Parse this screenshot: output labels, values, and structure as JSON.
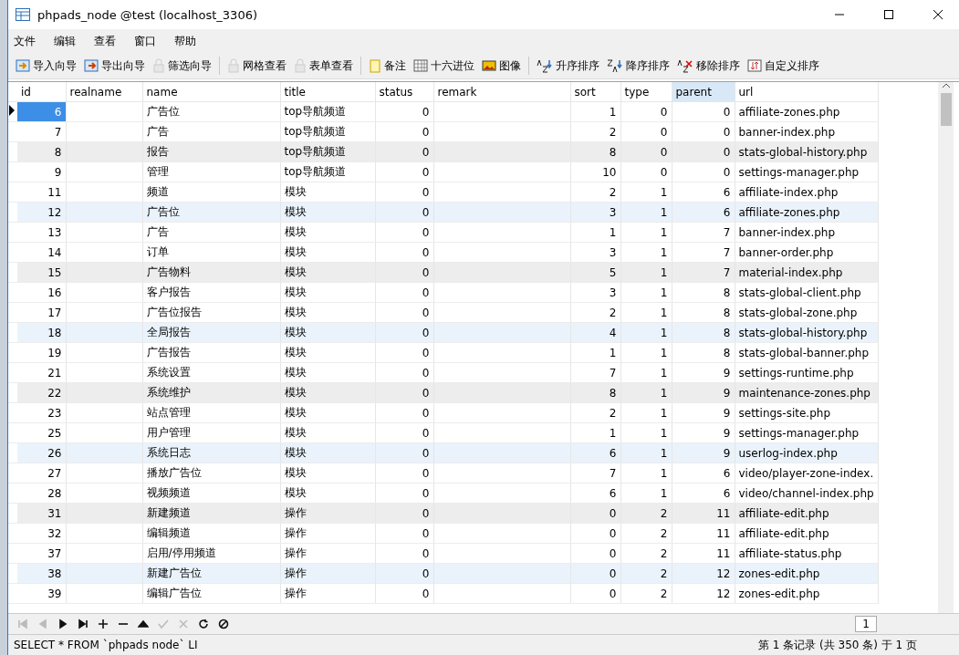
{
  "window": {
    "title": "phpads_node @test (localhost_3306)"
  },
  "menu": [
    "文件",
    "编辑",
    "查看",
    "窗口",
    "帮助"
  ],
  "toolbar": [
    [
      {
        "kind": "import",
        "label": "导入向导",
        "disabled": false
      },
      {
        "kind": "export",
        "label": "导出向导",
        "disabled": false
      },
      {
        "kind": "filter",
        "label": "筛选向导",
        "disabled": true
      }
    ],
    [
      {
        "kind": "grid",
        "label": "网格查看",
        "disabled": true
      },
      {
        "kind": "form",
        "label": "表单查看",
        "disabled": true
      }
    ],
    [
      {
        "kind": "note",
        "label": "备注",
        "disabled": false
      },
      {
        "kind": "hex",
        "label": "十六进位",
        "disabled": false
      },
      {
        "kind": "image",
        "label": "图像",
        "disabled": false
      }
    ],
    [
      {
        "kind": "asc",
        "label": "升序排序",
        "disabled": false
      },
      {
        "kind": "desc",
        "label": "降序排序",
        "disabled": false
      },
      {
        "kind": "remove",
        "label": "移除排序",
        "disabled": false
      },
      {
        "kind": "custom",
        "label": "自定义排序",
        "disabled": false
      }
    ]
  ],
  "table": {
    "columns": [
      {
        "label": "id",
        "selected": false
      },
      {
        "label": "realname",
        "selected": false
      },
      {
        "label": "name",
        "selected": false
      },
      {
        "label": "title",
        "selected": false
      },
      {
        "label": "status",
        "selected": false
      },
      {
        "label": "remark",
        "selected": false
      },
      {
        "label": "sort",
        "selected": false
      },
      {
        "label": "type",
        "selected": false
      },
      {
        "label": "parent",
        "selected": true
      },
      {
        "label": "url",
        "selected": false
      }
    ],
    "rows": [
      {
        "id": "6",
        "name": "广告位",
        "title": "top导航频道",
        "status": "0",
        "sort": "1",
        "type": "0",
        "parent": "0",
        "url": "affiliate-zones.php",
        "kind": "plain",
        "selected": true
      },
      {
        "id": "7",
        "name": "广告",
        "title": "top导航频道",
        "status": "0",
        "sort": "2",
        "type": "0",
        "parent": "0",
        "url": "banner-index.php",
        "kind": "plain",
        "selected": false
      },
      {
        "id": "8",
        "name": "报告",
        "title": "top导航频道",
        "status": "0",
        "sort": "8",
        "type": "0",
        "parent": "0",
        "url": "stats-global-history.php",
        "kind": "hovered",
        "selected": false
      },
      {
        "id": "9",
        "name": "管理",
        "title": "top导航频道",
        "status": "0",
        "sort": "10",
        "type": "0",
        "parent": "0",
        "url": "settings-manager.php",
        "kind": "plain",
        "selected": false
      },
      {
        "id": "11",
        "name": "频道",
        "title": "模块",
        "status": "0",
        "sort": "2",
        "type": "1",
        "parent": "6",
        "url": "affiliate-index.php",
        "kind": "plain",
        "selected": false
      },
      {
        "id": "12",
        "name": "广告位",
        "title": "模块",
        "status": "0",
        "sort": "3",
        "type": "1",
        "parent": "6",
        "url": "affiliate-zones.php",
        "kind": "tinted",
        "selected": false
      },
      {
        "id": "13",
        "name": "广告",
        "title": "模块",
        "status": "0",
        "sort": "1",
        "type": "1",
        "parent": "7",
        "url": "banner-index.php",
        "kind": "plain",
        "selected": false
      },
      {
        "id": "14",
        "name": "订单",
        "title": "模块",
        "status": "0",
        "sort": "3",
        "type": "1",
        "parent": "7",
        "url": "banner-order.php",
        "kind": "plain",
        "selected": false
      },
      {
        "id": "15",
        "name": "广告物料",
        "title": "模块",
        "status": "0",
        "sort": "5",
        "type": "1",
        "parent": "7",
        "url": "material-index.php",
        "kind": "hovered",
        "selected": false
      },
      {
        "id": "16",
        "name": "客户报告",
        "title": "模块",
        "status": "0",
        "sort": "3",
        "type": "1",
        "parent": "8",
        "url": "stats-global-client.php",
        "kind": "plain",
        "selected": false
      },
      {
        "id": "17",
        "name": "广告位报告",
        "title": "模块",
        "status": "0",
        "sort": "2",
        "type": "1",
        "parent": "8",
        "url": "stats-global-zone.php",
        "kind": "plain",
        "selected": false
      },
      {
        "id": "18",
        "name": "全局报告",
        "title": "模块",
        "status": "0",
        "sort": "4",
        "type": "1",
        "parent": "8",
        "url": "stats-global-history.php",
        "kind": "tinted",
        "selected": false
      },
      {
        "id": "19",
        "name": "广告报告",
        "title": "模块",
        "status": "0",
        "sort": "1",
        "type": "1",
        "parent": "8",
        "url": "stats-global-banner.php",
        "kind": "plain",
        "selected": false
      },
      {
        "id": "21",
        "name": "系统设置",
        "title": "模块",
        "status": "0",
        "sort": "7",
        "type": "1",
        "parent": "9",
        "url": "settings-runtime.php",
        "kind": "plain",
        "selected": false
      },
      {
        "id": "22",
        "name": "系统维护",
        "title": "模块",
        "status": "0",
        "sort": "8",
        "type": "1",
        "parent": "9",
        "url": "maintenance-zones.php",
        "kind": "hovered",
        "selected": false
      },
      {
        "id": "23",
        "name": "站点管理",
        "title": "模块",
        "status": "0",
        "sort": "2",
        "type": "1",
        "parent": "9",
        "url": "settings-site.php",
        "kind": "plain",
        "selected": false
      },
      {
        "id": "25",
        "name": "用户管理",
        "title": "模块",
        "status": "0",
        "sort": "1",
        "type": "1",
        "parent": "9",
        "url": "settings-manager.php",
        "kind": "plain",
        "selected": false
      },
      {
        "id": "26",
        "name": "系统日志",
        "title": "模块",
        "status": "0",
        "sort": "6",
        "type": "1",
        "parent": "9",
        "url": "userlog-index.php",
        "kind": "tinted",
        "selected": false
      },
      {
        "id": "27",
        "name": "播放广告位",
        "title": "模块",
        "status": "0",
        "sort": "7",
        "type": "1",
        "parent": "6",
        "url": "video/player-zone-index.",
        "kind": "plain",
        "selected": false
      },
      {
        "id": "28",
        "name": "视频频道",
        "title": "模块",
        "status": "0",
        "sort": "6",
        "type": "1",
        "parent": "6",
        "url": "video/channel-index.php",
        "kind": "plain",
        "selected": false
      },
      {
        "id": "31",
        "name": "新建频道",
        "title": "操作",
        "status": "0",
        "sort": "0",
        "type": "2",
        "parent": "11",
        "url": "affiliate-edit.php",
        "kind": "hovered",
        "selected": false
      },
      {
        "id": "32",
        "name": "编辑频道",
        "title": "操作",
        "status": "0",
        "sort": "0",
        "type": "2",
        "parent": "11",
        "url": "affiliate-edit.php",
        "kind": "plain",
        "selected": false
      },
      {
        "id": "37",
        "name": "启用/停用频道",
        "title": "操作",
        "status": "0",
        "sort": "0",
        "type": "2",
        "parent": "11",
        "url": "affiliate-status.php",
        "kind": "plain",
        "selected": false
      },
      {
        "id": "38",
        "name": "新建广告位",
        "title": "操作",
        "status": "0",
        "sort": "0",
        "type": "2",
        "parent": "12",
        "url": "zones-edit.php",
        "kind": "tinted",
        "selected": false
      },
      {
        "id": "39",
        "name": "编辑广告位",
        "title": "操作",
        "status": "0",
        "sort": "0",
        "type": "2",
        "parent": "12",
        "url": "zones-edit.php",
        "kind": "plain",
        "selected": false
      }
    ]
  },
  "navigator": [
    {
      "kind": "first",
      "disabled": true
    },
    {
      "kind": "prev",
      "disabled": true
    },
    {
      "kind": "next",
      "disabled": false
    },
    {
      "kind": "last",
      "disabled": false
    },
    {
      "kind": "add",
      "disabled": false
    },
    {
      "kind": "delete",
      "disabled": false
    },
    {
      "kind": "up",
      "disabled": false
    },
    {
      "kind": "check",
      "disabled": true
    },
    {
      "kind": "cancel",
      "disabled": true
    },
    {
      "kind": "refresh",
      "disabled": false
    },
    {
      "kind": "stop",
      "disabled": false
    }
  ],
  "pager": {
    "page": "1"
  },
  "status_bar": {
    "sql": "SELECT * FROM `phpads node` LI",
    "record": "第 1 条记录 (共 350 条) 于 1 页"
  }
}
